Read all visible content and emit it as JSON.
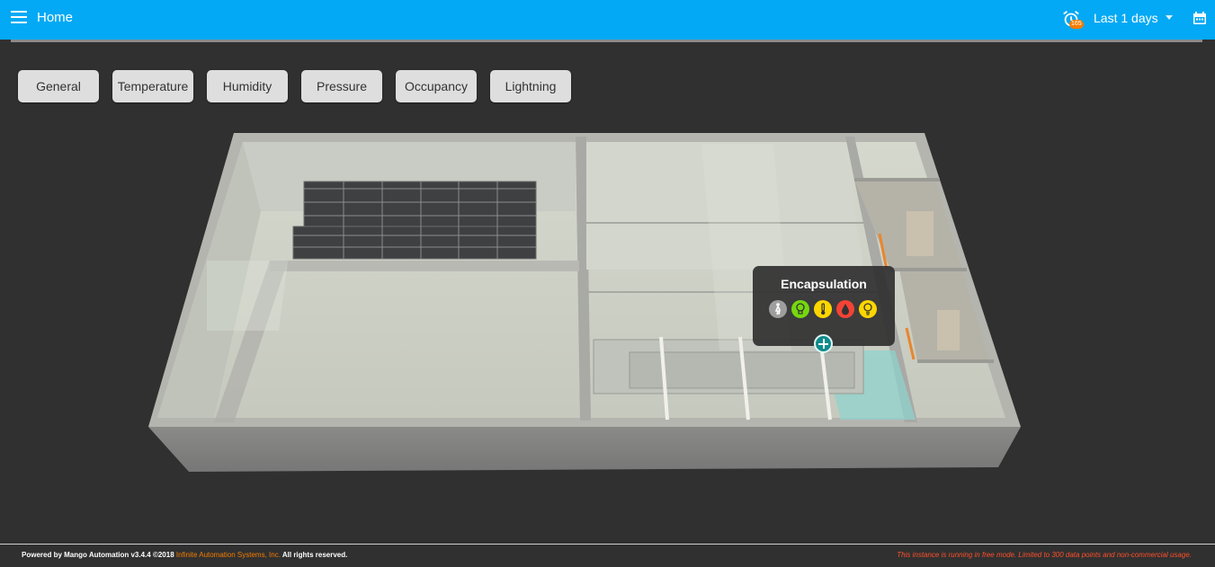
{
  "header": {
    "title": "Home",
    "alarm_count": "165",
    "period_label": "Last 1 days"
  },
  "filters": [
    "General",
    "Temperature",
    "Humidity",
    "Pressure",
    "Occupancy",
    "Lightning"
  ],
  "popup": {
    "title": "Encapsulation",
    "sensors": [
      {
        "name": "occupancy-icon",
        "color": "#9e9e9e"
      },
      {
        "name": "lighting-icon",
        "color": "#76d70f"
      },
      {
        "name": "temperature-icon",
        "color": "#fdd600"
      },
      {
        "name": "humidity-icon",
        "color": "#f44336"
      },
      {
        "name": "bulb-icon",
        "color": "#fdd600"
      }
    ]
  },
  "footer": {
    "powered": "Powered by Mango Automation v3.4.4 ©2018",
    "company": "Infinite Automation Systems, Inc.",
    "rights": "All rights reserved.",
    "notice": "This instance is running in free mode. Limited to 300 data points and non-commercial usage."
  },
  "colors": {
    "topbar": "#03a9f4",
    "background": "#303030",
    "accent_orange": "#f57c00",
    "notice_red": "#ff4f2b"
  }
}
